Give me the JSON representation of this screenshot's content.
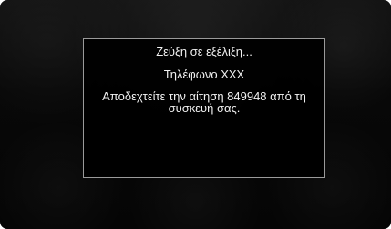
{
  "dialog": {
    "status": "Ζεύξη σε εξέλιξη...",
    "device": "Τηλέφωνο XXX",
    "message": "Αποδεχτείτε την αίτηση 849948 από τη συσκευή σας."
  }
}
